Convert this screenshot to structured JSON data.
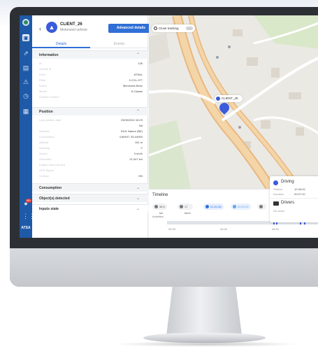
{
  "vehicle": {
    "name": "CLIENT_26",
    "subtitle": "Motorized vehicle",
    "advanced_button": "Advanced details",
    "tabs": [
      "Details",
      "Events"
    ]
  },
  "sections": {
    "information": {
      "title": "Information",
      "rows": [
        {
          "key": "Id",
          "value": "126"
        },
        {
          "key": "Vehicle id",
          "value": ""
        },
        {
          "key": "Fleet",
          "value": "ATSAL"
        },
        {
          "key": "Plate",
          "value": "2-CXL-977"
        },
        {
          "key": "Brand",
          "value": "Mercedes-Benz"
        },
        {
          "key": "Model",
          "value": "A-Classe"
        },
        {
          "key": "Chassis number",
          "value": ""
        }
      ]
    },
    "position": {
      "title": "Position",
      "rows": [
        {
          "key": "Last position date",
          "value": "23/05/2024 16:29"
        },
        {
          "key": "",
          "value": "Nd"
        },
        {
          "key": "Address",
          "value": "5101 Namur (BE)"
        },
        {
          "key": "Coordinates",
          "value": "4.89497, 50.44900"
        },
        {
          "key": "Altitude",
          "value": "151 m"
        },
        {
          "key": "Heading",
          "value": "↗"
        },
        {
          "key": "Speed",
          "value": "0 km/h"
        },
        {
          "key": "Odometer",
          "value": "21,047 km"
        },
        {
          "key": "Engine hours (h/min)",
          "value": ""
        },
        {
          "key": "GPS Signal",
          "value": ""
        },
        {
          "key": "Contact",
          "value": "ON"
        }
      ]
    },
    "consumption": {
      "title": "Consumption"
    },
    "objects": {
      "title": "Object(s) detected"
    },
    "inputs": {
      "title": "Inputs state"
    }
  },
  "map": {
    "close_tracking": "Close tracking",
    "vehicle_label": "CLIENT_26"
  },
  "driving_card": {
    "title": "Driving",
    "rows": [
      {
        "key": "Started",
        "value": "10:38:26"
      },
      {
        "key": "Duration",
        "value": "00:07:20"
      }
    ],
    "drivers_title": "Drivers",
    "no_driver": "No driver"
  },
  "timeline": {
    "title": "Timeline",
    "chips": [
      "38.9 km",
      "17 km/h",
      "01:51:56",
      "00:00:00",
      ""
    ],
    "activities_label": "Activities",
    "hours": [
      "00:00",
      "04:00",
      "08:00"
    ]
  },
  "nav": {
    "brand": "ATSA",
    "badge": "99+"
  },
  "colors": {
    "accent": "#2f6fd6",
    "nav": "#1f5aa8",
    "vehicle": "#3b5bdb"
  }
}
